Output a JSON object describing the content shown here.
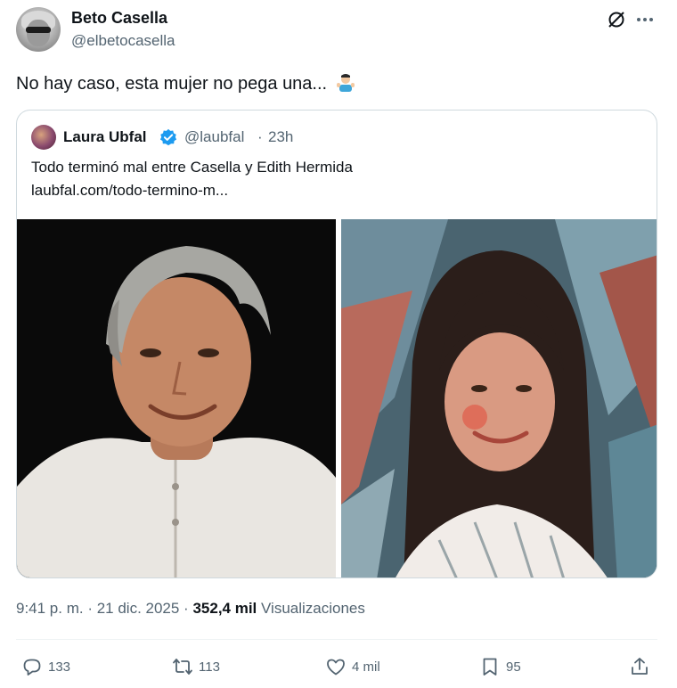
{
  "author": {
    "name": "Beto Casella",
    "handle": "@elbetocasella"
  },
  "tweet": {
    "text": "No hay caso, esta mujer no pega una...",
    "emoji": "man-shrugging-emoji"
  },
  "quoted": {
    "name": "Laura Ubfal",
    "handle": "@laubfal",
    "separator": "·",
    "time": "23h",
    "text": "Todo terminó mal entre Casella y Edith Hermida",
    "link": "laubfal.com/todo-termino-m..."
  },
  "meta": {
    "time": "9:41 p. m. · 21 dic. 2025 · ",
    "views_count": "352,4 mil",
    "views_label": " Visualizaciones"
  },
  "actions": {
    "replies": "133",
    "reposts": "113",
    "likes": "4 mil",
    "bookmarks": "95"
  },
  "colors": {
    "text": "#0f1419",
    "secondary": "#536471",
    "border": "#cfd9de",
    "verified": "#1d9bf0"
  }
}
